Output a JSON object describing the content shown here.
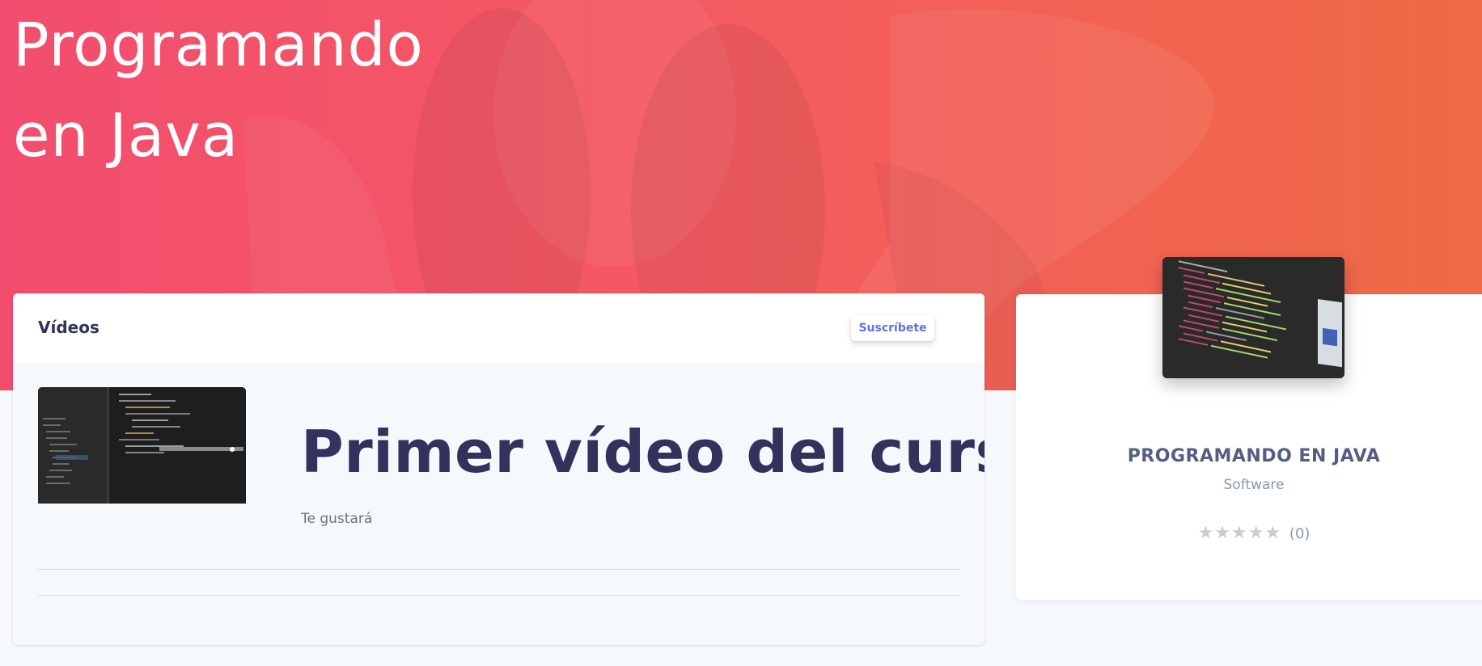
{
  "hero": {
    "title_line1": "Programando",
    "title_line2": "en Java"
  },
  "videos": {
    "title": "Vídeos",
    "subscribe_label": "Suscríbete",
    "items": [
      {
        "title": "Primer vídeo del curso",
        "description": "Te gustará"
      }
    ]
  },
  "course": {
    "name": "PROGRAMANDO EN JAVA",
    "category": "Software",
    "stars": "★★★★★",
    "rating_count": "(0)"
  },
  "colors": {
    "hero_gradient_start": "#f24d6e",
    "hero_gradient_end": "#f06a45",
    "accent": "#5e72e4",
    "heading": "#32325d",
    "muted": "#8898aa"
  }
}
